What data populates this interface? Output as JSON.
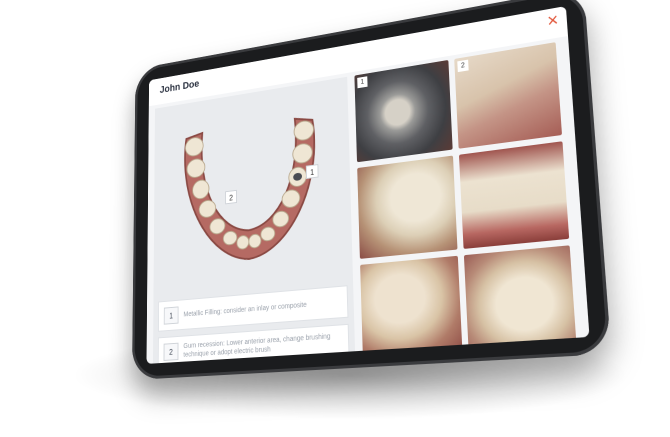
{
  "patient_name": "John Doe",
  "close_icon": "×",
  "accent_color": "#e2573b",
  "scan_markers": [
    {
      "label": "1"
    },
    {
      "label": "2"
    }
  ],
  "findings": [
    {
      "number": "1",
      "text": "Metallic Filling: consider an inlay or composite"
    },
    {
      "number": "2",
      "text": "Gum recession: Lower anterior area, change brushing technique or adopt electric brush"
    }
  ],
  "photos": [
    {
      "tag": "1"
    },
    {
      "tag": "2"
    },
    {
      "tag": ""
    },
    {
      "tag": ""
    },
    {
      "tag": ""
    },
    {
      "tag": ""
    }
  ]
}
